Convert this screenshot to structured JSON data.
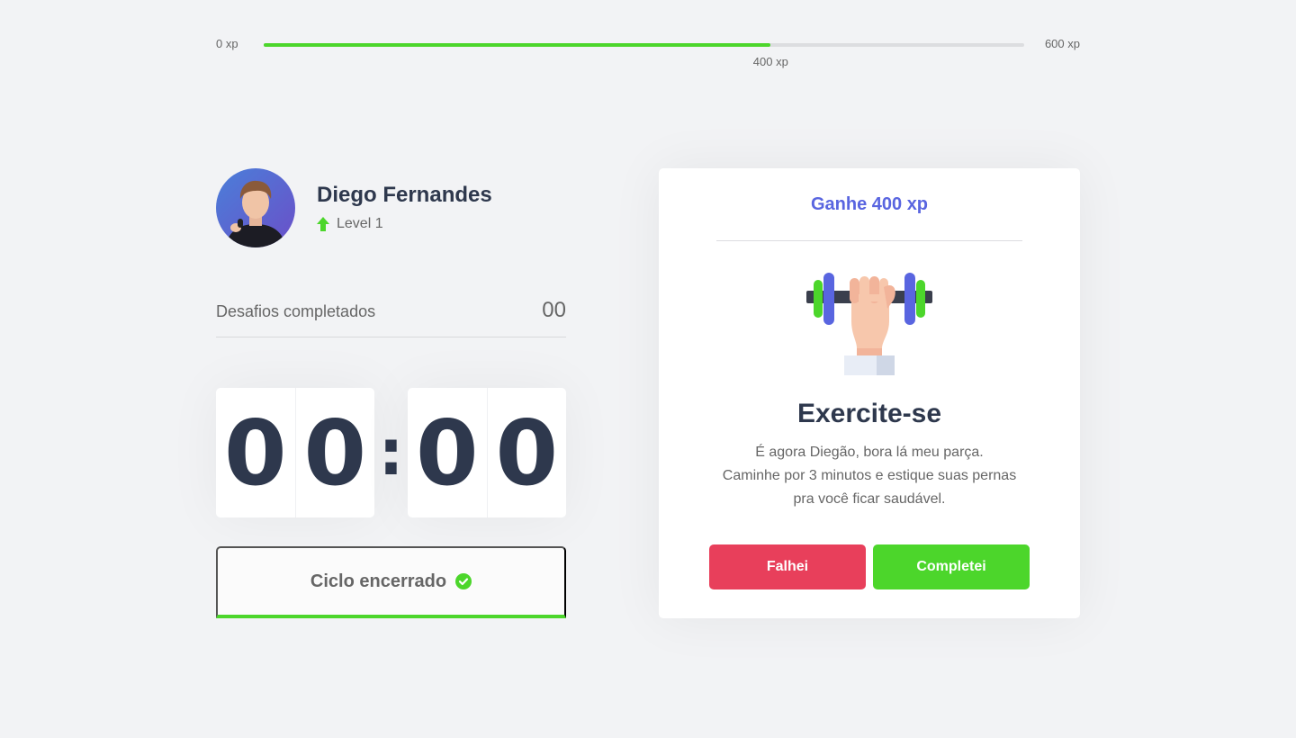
{
  "xp": {
    "min_label": "0 xp",
    "max_label": "600 xp",
    "current_label": "400 xp",
    "current": 400,
    "max": 600,
    "color": "#4cd62b"
  },
  "profile": {
    "name": "Diego Fernandes",
    "level_label": "Level 1",
    "level_icon": "level-up-arrow-icon"
  },
  "completed_challenges": {
    "label": "Desafios completados",
    "count": "00"
  },
  "countdown": {
    "minute_left": "0",
    "minute_right": "0",
    "separator": ":",
    "second_left": "0",
    "second_right": "0"
  },
  "cycle_button": {
    "label": "Ciclo encerrado",
    "icon": "check-circle-icon",
    "accent": "#4cd62b"
  },
  "challenge": {
    "header": "Ganhe 400 xp",
    "illustration": "dumbbell-body-icon",
    "title": "Exercite-se",
    "description_lines": [
      "É agora Diegão, bora lá meu parça.",
      "Caminhe por 3 minutos e estique suas pernas",
      "pra você ficar saudável."
    ],
    "fail_label": "Falhei",
    "success_label": "Completei"
  },
  "colors": {
    "background": "#f2f3f5",
    "text": "#2e384d",
    "muted": "#666666",
    "blue": "#5965e0",
    "red": "#e83f5b",
    "green": "#4cd62b"
  }
}
